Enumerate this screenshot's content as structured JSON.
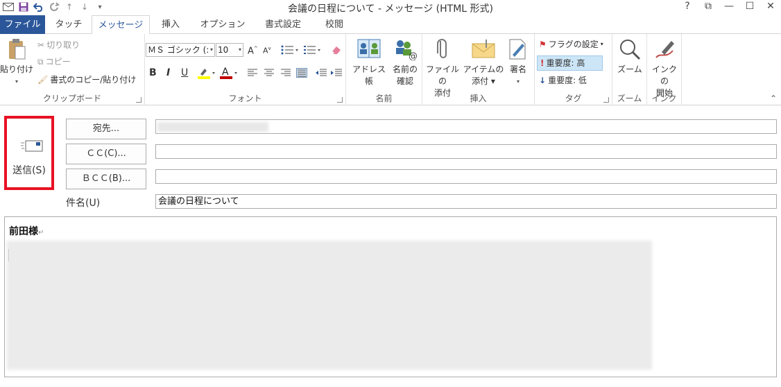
{
  "window": {
    "title": "会議の日程について - メッセージ (HTML 形式)",
    "controls": [
      "?",
      "⧉",
      "—",
      "☐",
      "✕"
    ]
  },
  "tabs": {
    "file": "ファイル",
    "touch": "タッチ",
    "message": "メッセージ",
    "insert": "挿入",
    "options": "オプション",
    "format": "書式設定",
    "review": "校閲"
  },
  "ribbon": {
    "clipboard": {
      "paste": "貼り付け",
      "cut": "切り取り",
      "copy": "コピー",
      "format_painter": "書式のコピー/貼り付け",
      "label": "クリップボード"
    },
    "font": {
      "font_name": "ＭＳ ゴシック (:",
      "font_size": "10",
      "label": "フォント"
    },
    "names": {
      "address_book": "アドレス帳",
      "check_names_1": "名前の",
      "check_names_2": "確認",
      "label": "名前"
    },
    "include": {
      "attach_file_1": "ファイルの",
      "attach_file_2": "添付",
      "attach_item_1": "アイテムの",
      "attach_item_2": "添付 ▾",
      "signature": "署名",
      "label": "挿入"
    },
    "tags": {
      "follow_up": "フラグの設定",
      "high_importance": "重要度: 高",
      "low_importance": "重要度: 低",
      "label": "タグ"
    },
    "zoom": {
      "zoom": "ズーム",
      "label": "ズーム"
    },
    "ink": {
      "start_inking_1": "インクの",
      "start_inking_2": "開始",
      "label": "インク"
    }
  },
  "compose": {
    "send_label": "送信(S)",
    "to_button": "宛先...",
    "cc_button": "ＣＣ(C)...",
    "bcc_button": "ＢＣＣ(B)...",
    "subject_label": "件名(U)",
    "subject_value": "会議の日程について",
    "body_greeting": "前田様"
  },
  "colors": {
    "file_tab": "#2b579a",
    "highlight_border": "#e81123",
    "active_importance_bg": "#cde6f7"
  }
}
